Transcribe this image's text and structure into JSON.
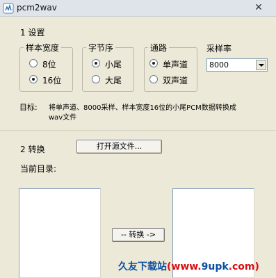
{
  "window": {
    "title": "pcm2wav",
    "close_glyph": "✕"
  },
  "settings": {
    "section_label": "1 设置",
    "sample_width": {
      "legend": "样本宽度",
      "options": [
        {
          "label": "8位",
          "checked": false
        },
        {
          "label": "16位",
          "checked": true
        }
      ]
    },
    "byte_order": {
      "legend": "字节序",
      "options": [
        {
          "label": "小尾",
          "checked": true
        },
        {
          "label": "大尾",
          "checked": false
        }
      ]
    },
    "channel": {
      "legend": "通路",
      "options": [
        {
          "label": "单声道",
          "checked": true
        },
        {
          "label": "双声道",
          "checked": false
        }
      ]
    },
    "sample_rate": {
      "label": "采样率",
      "value": "8000"
    },
    "target_label": "目标:",
    "target_line1": "将单声道、8000采样、样本宽度16位的小尾PCM数据转换成",
    "target_line2": "wav文件"
  },
  "convert": {
    "section_label": "2 转换",
    "open_button": "打开源文件...",
    "current_dir_label": "当前目录:",
    "convert_button": "-- 转换 ->"
  },
  "watermark": {
    "part1": "久友下载站",
    "part2": "(www.",
    "part3": "9upk",
    "part4": ".com)"
  }
}
